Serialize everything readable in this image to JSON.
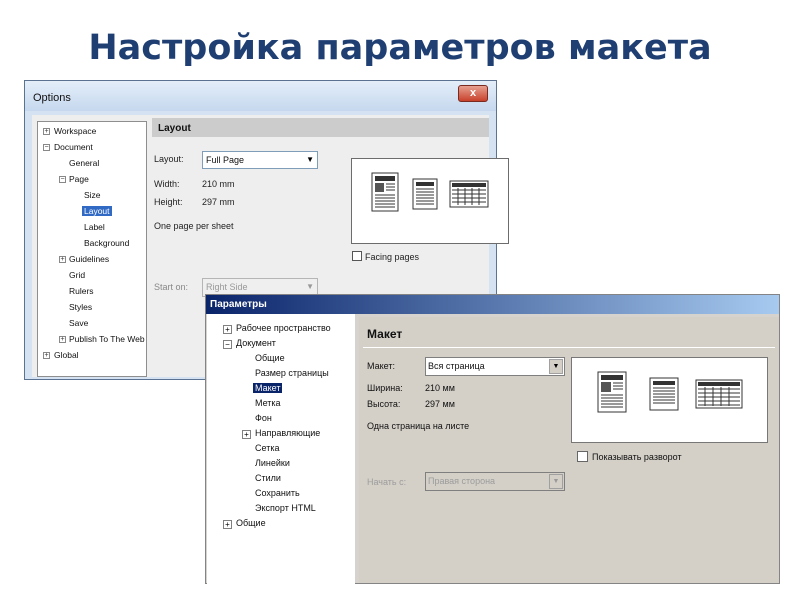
{
  "slide": {
    "title": "Настройка параметров макета"
  },
  "en": {
    "window_title": "Options",
    "close_glyph": "x",
    "tree": [
      "Workspace",
      "Document",
      "General",
      "Page",
      "Size",
      "Layout",
      "Label",
      "Background",
      "Guidelines",
      "Grid",
      "Rulers",
      "Styles",
      "Save",
      "Publish To The Web",
      "Global"
    ],
    "selected_item": "Layout",
    "panel_title": "Layout",
    "layout_label": "Layout:",
    "layout_value": "Full Page",
    "width_label": "Width:",
    "width_value": "210 mm",
    "height_label": "Height:",
    "height_value": "297 mm",
    "info": "One page per sheet",
    "facing_pages": "Facing pages",
    "facing_pages_checked": false,
    "start_on_label": "Start on:",
    "start_on_value": "Right Side"
  },
  "ru": {
    "window_title": "Параметры",
    "tree": [
      "Рабочее пространство",
      "Документ",
      "Общие",
      "Размер страницы",
      "Макет",
      "Метка",
      "Фон",
      "Направляющие",
      "Сетка",
      "Линейки",
      "Стили",
      "Сохранить",
      "Экспорт HTML",
      "Общие"
    ],
    "selected_item": "Макет",
    "panel_title": "Макет",
    "layout_label": "Макет:",
    "layout_value": "Вся страница",
    "width_label": "Ширина:",
    "width_value": "210 мм",
    "height_label": "Высота:",
    "height_value": "297 мм",
    "info": "Одна страница на листе",
    "facing_pages": "Показывать разворот",
    "facing_pages_checked": false,
    "start_on_label": "Начать с:",
    "start_on_value": "Правая сторона"
  },
  "tree_glyphs": {
    "expanded": "−",
    "collapsed": "+"
  },
  "dropdown_arrow": "▼",
  "colors": {
    "title": "#1f3f73",
    "selection_en": "#316ac5",
    "selection_ru": "#0a246a"
  }
}
